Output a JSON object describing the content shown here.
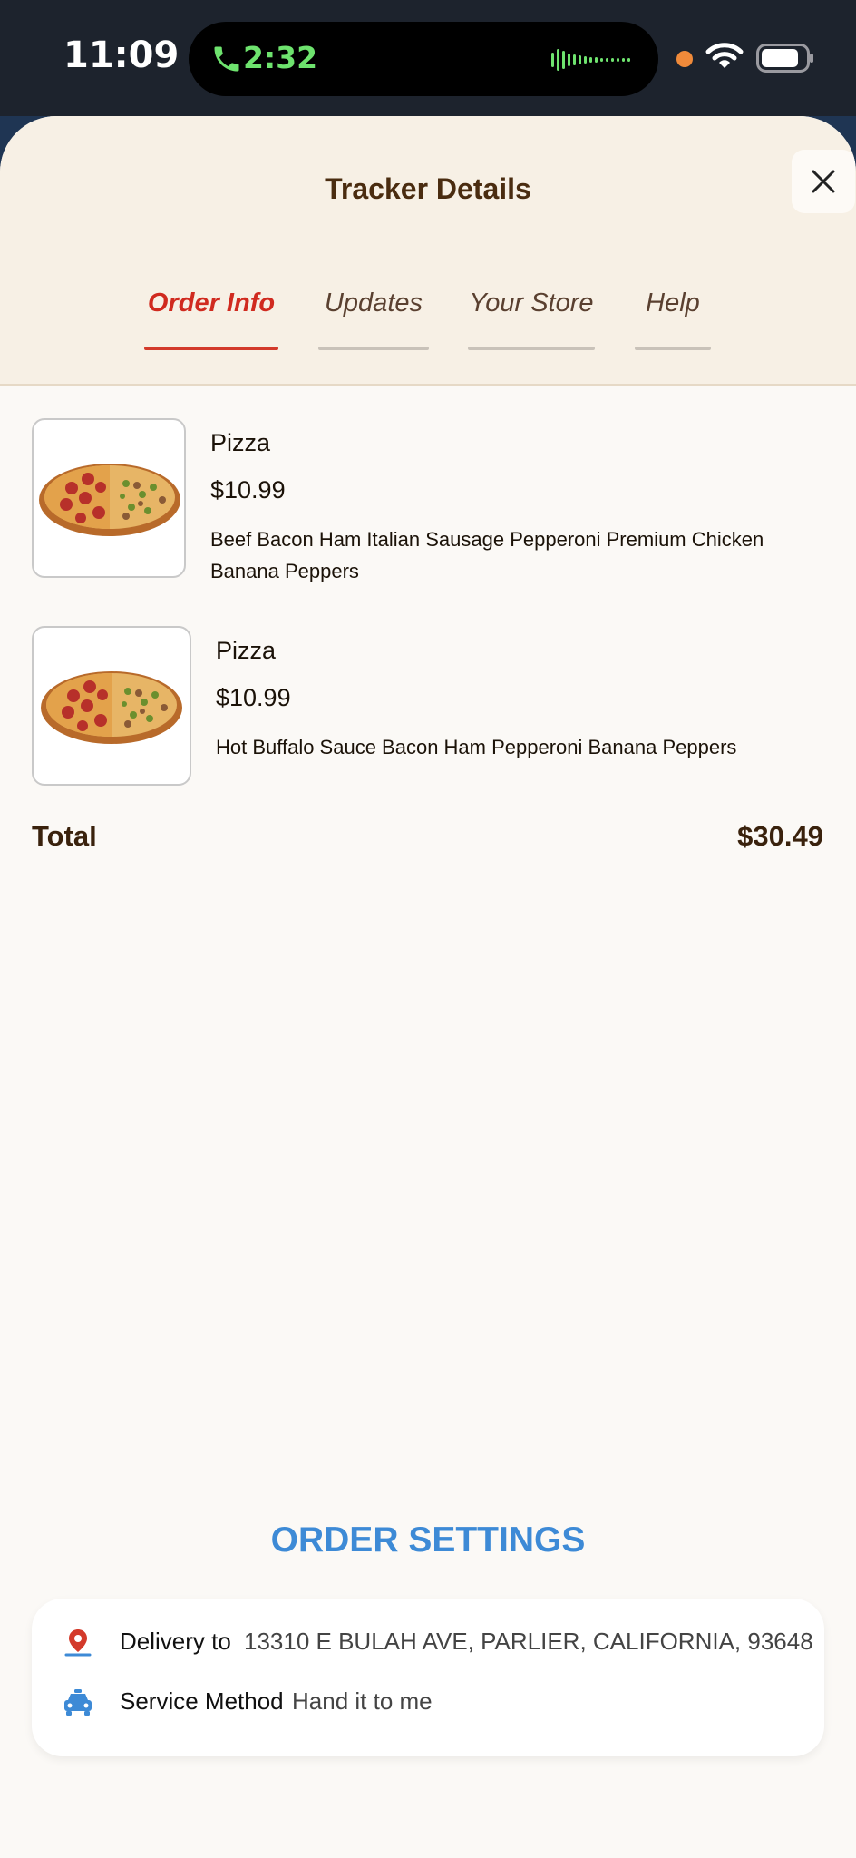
{
  "status_bar": {
    "time": "11:09",
    "call_timer": "2:32"
  },
  "sheet": {
    "title": "Tracker Details",
    "tabs": [
      {
        "label": "Order Info",
        "active": true
      },
      {
        "label": "Updates",
        "active": false
      },
      {
        "label": "Your Store",
        "active": false
      },
      {
        "label": "Help",
        "active": false
      }
    ]
  },
  "order": {
    "items": [
      {
        "name": "Pizza",
        "price": "$10.99",
        "toppings": "Beef Bacon Ham Italian Sausage Pepperoni Premium Chicken Banana Peppers",
        "image": "pizza-image"
      },
      {
        "name": "Pizza",
        "price": "$10.99",
        "toppings": "Hot Buffalo Sauce Bacon Ham Pepperoni Banana Peppers",
        "image": "pizza-image"
      }
    ],
    "total_label": "Total",
    "total_value": "$30.49"
  },
  "order_settings": {
    "title": "ORDER SETTINGS",
    "delivery_label": "Delivery to",
    "delivery_address": "13310 E BULAH AVE, PARLIER, CALIFORNIA, 93648",
    "service_label": "Service Method",
    "service_value": "Hand it to me"
  },
  "colors": {
    "accent_red": "#d02a1f",
    "accent_blue": "#3d8ad6",
    "header_bg": "#f7f0e5",
    "brown_text": "#4a2c10"
  },
  "icons": [
    "phone-icon",
    "waveform-icon",
    "wifi-icon",
    "battery-icon",
    "close-icon",
    "location-pin-icon",
    "car-icon"
  ]
}
